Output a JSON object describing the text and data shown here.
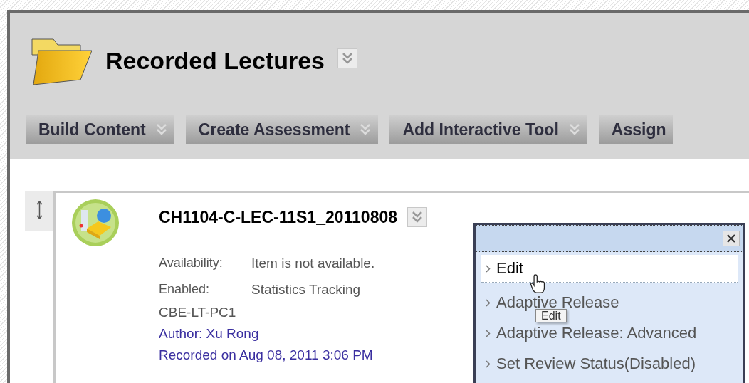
{
  "header": {
    "title": "Recorded Lectures"
  },
  "toolbar": [
    {
      "label": "Build Content",
      "dropdown": true
    },
    {
      "label": "Create Assessment",
      "dropdown": true
    },
    {
      "label": "Add Interactive Tool",
      "dropdown": true
    },
    {
      "label": "Assign",
      "dropdown": false
    }
  ],
  "item": {
    "title": "CH1104-C-LEC-11S1_20110808",
    "availability": {
      "label": "Availability:",
      "value": "Item is not available."
    },
    "enabled": {
      "label": "Enabled:",
      "value": "Statistics Tracking"
    },
    "lines": [
      {
        "text": "CBE-LT-PC1",
        "kind": "plain"
      },
      {
        "text": "Author: Xu Rong",
        "kind": "meta"
      },
      {
        "text": "Recorded on Aug 08, 2011 3:06 PM",
        "kind": "meta"
      }
    ]
  },
  "menu": {
    "items": [
      {
        "label": "Edit",
        "selected": true
      },
      {
        "label": "Adaptive Release",
        "selected": false
      },
      {
        "label": "Adaptive Release: Advanced",
        "selected": false
      },
      {
        "label": "Set Review Status(Disabled)",
        "selected": false
      }
    ],
    "tooltip": "Edit"
  }
}
